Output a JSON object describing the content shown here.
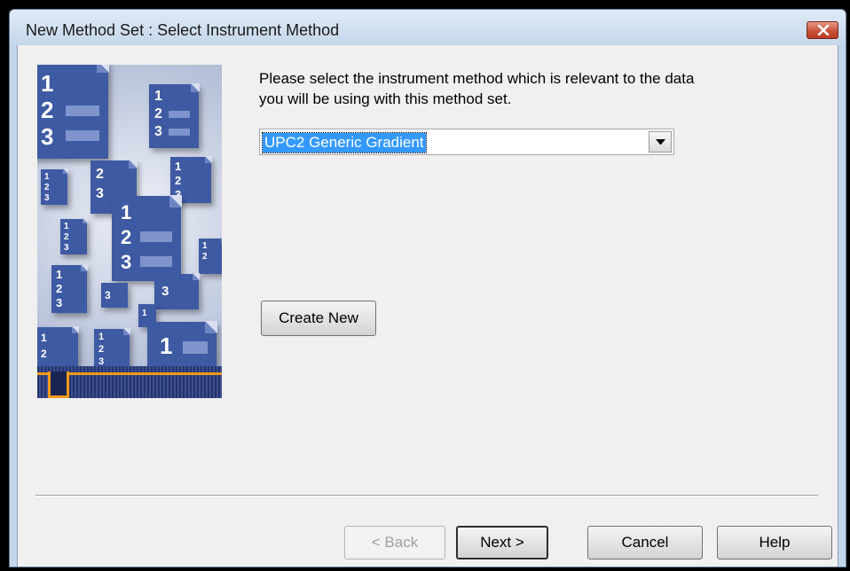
{
  "window": {
    "title": "New Method Set : Select Instrument Method"
  },
  "instruction": "Please select the instrument method which is relevant to the data you will be using with this method set.",
  "method_select": {
    "selected": "UPC2 Generic Gradient"
  },
  "create_new_label": "Create New",
  "footer": {
    "back_label": "< Back",
    "next_label": "Next >",
    "cancel_label": "Cancel",
    "help_label": "Help"
  },
  "icons": {
    "close": "close-icon",
    "dropdown": "chevron-down-icon"
  },
  "illustration_digits": [
    "1",
    "2",
    "3"
  ]
}
